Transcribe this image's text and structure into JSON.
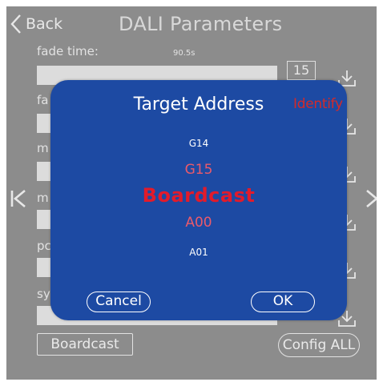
{
  "header": {
    "back_label": "Back",
    "title": "DALI Parameters"
  },
  "params": {
    "fade_time": {
      "label": "fade time:",
      "value": "90.5s"
    },
    "p2_fragment": "fa",
    "p3_fragment": "m",
    "p4_fragment": "m",
    "p5_fragment": "pc",
    "p6_fragment": "sy",
    "fade_time_number": "15"
  },
  "footer": {
    "broadcast_label": "Boardcast",
    "config_all_label": "Config ALL"
  },
  "dialog": {
    "title": "Target Address",
    "identify_label": "Identify",
    "addresses": {
      "prev2": "G14",
      "prev1": "G15",
      "selected": "Boardcast",
      "next1": "A00",
      "next2": "A01"
    },
    "cancel_label": "Cancel",
    "ok_label": "OK"
  },
  "colors": {
    "background": "#8c8c8c",
    "dialog_background": "#1d4aa3",
    "selected_address": "#e21b2b",
    "near_address": "#ea5a6b",
    "identify": "#d32a2a"
  },
  "icons": {
    "back": "chevron-left-icon",
    "download": "download-icon",
    "previous_page": "skip-previous-icon",
    "next_page": "skip-next-icon"
  }
}
